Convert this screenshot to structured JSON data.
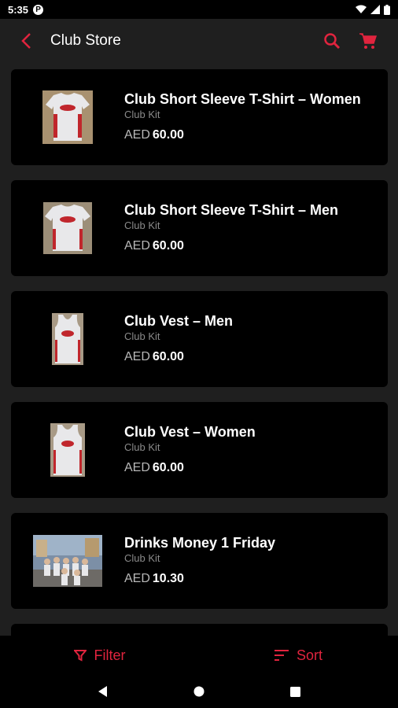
{
  "status": {
    "time": "5:35",
    "badge": "P"
  },
  "header": {
    "title": "Club Store"
  },
  "products": [
    {
      "title": "Club Short Sleeve T-Shirt – Women",
      "category": "Club Kit",
      "currency": "AED",
      "price": "60.00",
      "image": "tshirt-women"
    },
    {
      "title": "Club Short Sleeve T-Shirt – Men",
      "category": "Club Kit",
      "currency": "AED",
      "price": "60.00",
      "image": "tshirt-men"
    },
    {
      "title": "Club Vest – Men",
      "category": "Club Kit",
      "currency": "AED",
      "price": "60.00",
      "image": "vest-men"
    },
    {
      "title": "Club Vest – Women",
      "category": "Club Kit",
      "currency": "AED",
      "price": "60.00",
      "image": "vest-women"
    },
    {
      "title": "Drinks Money 1 Friday",
      "category": "Club Kit",
      "currency": "AED",
      "price": "10.30",
      "image": "group-photo"
    }
  ],
  "actions": {
    "filter_label": "Filter",
    "sort_label": "Sort"
  },
  "colors": {
    "accent": "#e0243e",
    "card": "#000000",
    "background": "#1f1f1f"
  },
  "icons": [
    "back-arrow-icon",
    "search-icon",
    "cart-icon",
    "filter-icon",
    "sort-icon",
    "nav-back-icon",
    "nav-home-icon",
    "nav-recents-icon"
  ]
}
